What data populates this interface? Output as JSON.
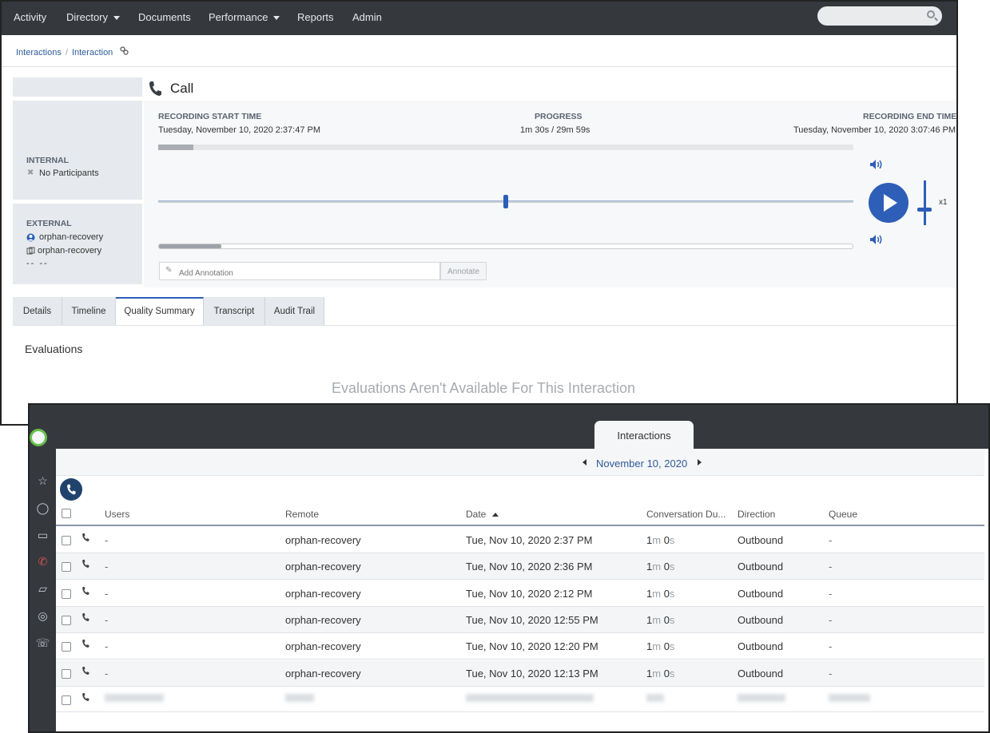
{
  "nav": {
    "items": [
      {
        "label": "Activity",
        "dropdown": false
      },
      {
        "label": "Directory",
        "dropdown": true
      },
      {
        "label": "Documents",
        "dropdown": false
      },
      {
        "label": "Performance",
        "dropdown": true
      },
      {
        "label": "Reports",
        "dropdown": false
      },
      {
        "label": "Admin",
        "dropdown": false
      }
    ],
    "search_icon": "search-icon"
  },
  "breadcrumb": {
    "root": "Interactions",
    "separator": "/",
    "current": "Interaction"
  },
  "participants": {
    "internal": {
      "heading": "INTERNAL",
      "value": "No Participants"
    },
    "external": {
      "heading": "EXTERNAL",
      "name": "orphan-recovery",
      "station": "orphan-recovery",
      "extra": "-- --"
    }
  },
  "call": {
    "title": "Call"
  },
  "recording": {
    "start_label": "RECORDING START TIME",
    "start_value": "Tuesday, November 10, 2020 2:37:47 PM",
    "progress_label": "PROGRESS",
    "progress_value": "1m 30s / 29m 59s",
    "progress_fraction": 0.05,
    "end_label": "RECORDING END TIME",
    "end_value": "Tuesday, November 10, 2020 3:07:46 PM",
    "playhead_fraction": 0.5,
    "speed": "x1"
  },
  "annotation": {
    "placeholder": "Add Annotation",
    "button": "Annotate"
  },
  "tabs": [
    {
      "label": "Details"
    },
    {
      "label": "Timeline"
    },
    {
      "label": "Quality Summary",
      "active": true
    },
    {
      "label": "Transcript"
    },
    {
      "label": "Audit Trail"
    }
  ],
  "evaluations": {
    "title": "Evaluations",
    "empty": "Evaluations Aren't Available For This Interaction"
  },
  "interactions": {
    "tab": "Interactions",
    "date": "November 10, 2020",
    "columns": [
      "Users",
      "Remote",
      "Date",
      "Conversation Du...",
      "Direction",
      "Queue"
    ],
    "rows": [
      {
        "users": "-",
        "remote": "orphan-recovery",
        "date": "Tue, Nov 10, 2020 2:37 PM",
        "dur_m": "1",
        "dur_s": "0",
        "direction": "Outbound",
        "queue": "-"
      },
      {
        "users": "-",
        "remote": "orphan-recovery",
        "date": "Tue, Nov 10, 2020 2:36 PM",
        "dur_m": "1",
        "dur_s": "0",
        "direction": "Outbound",
        "queue": "-"
      },
      {
        "users": "-",
        "remote": "orphan-recovery",
        "date": "Tue, Nov 10, 2020 2:12 PM",
        "dur_m": "1",
        "dur_s": "0",
        "direction": "Outbound",
        "queue": "-"
      },
      {
        "users": "-",
        "remote": "orphan-recovery",
        "date": "Tue, Nov 10, 2020 12:55 PM",
        "dur_m": "1",
        "dur_s": "0",
        "direction": "Outbound",
        "queue": "-"
      },
      {
        "users": "-",
        "remote": "orphan-recovery",
        "date": "Tue, Nov 10, 2020 12:20 PM",
        "dur_m": "1",
        "dur_s": "0",
        "direction": "Outbound",
        "queue": "-"
      },
      {
        "users": "-",
        "remote": "orphan-recovery",
        "date": "Tue, Nov 10, 2020 12:13 PM",
        "dur_m": "1",
        "dur_s": "0",
        "direction": "Outbound",
        "queue": "-"
      }
    ]
  },
  "colors": {
    "nav_bg": "#35393e",
    "accent": "#2d5fb8",
    "link": "#2e5b9a",
    "presence": "#67c04b"
  }
}
